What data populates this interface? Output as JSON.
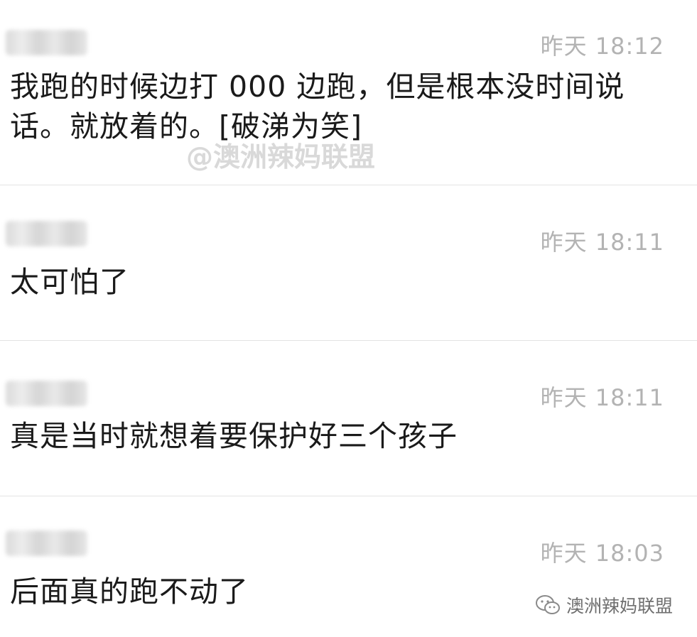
{
  "messages": [
    {
      "time": "昨天 18:12",
      "text": "我跑的时候边打 000 边跑，但是根本没时间说话。就放着的。[破涕为笑]"
    },
    {
      "time": "昨天 18:11",
      "text": "太可怕了"
    },
    {
      "time": "昨天 18:11",
      "text": "真是当时就想着要保护好三个孩子"
    },
    {
      "time": "昨天 18:03",
      "text": "后面真的跑不动了"
    }
  ],
  "watermark": {
    "center_text": "@澳洲辣妈联盟",
    "corner_text": "澳洲辣妈联盟",
    "corner_icon": "wechat-icon"
  }
}
